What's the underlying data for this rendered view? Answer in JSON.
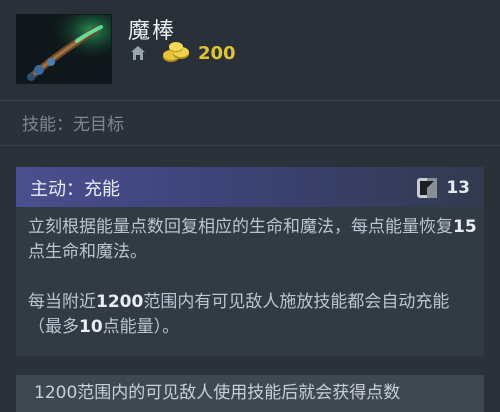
{
  "item": {
    "name": "魔棒",
    "gold_cost": "200",
    "icon": "magic-stick-icon"
  },
  "targeting": "技能：无目标",
  "active": {
    "title": "主动：充能",
    "cooldown": "13",
    "cooldown_icon": "cooldown-icon",
    "desc1_pre": "立刻根据能量点数回复相应的生命和魔法，每点能量恢复",
    "desc1_num": "15",
    "desc1_post": "点生命和魔法。",
    "desc2_pre": "每当附近",
    "desc2_num1": "1200",
    "desc2_mid": "范围内有可见敌人施放技能都会自动充能（最多",
    "desc2_num2": "10",
    "desc2_post": "点能量）。"
  },
  "note": {
    "text": "1200范围内的可见敌人使用技能后就会获得点数"
  },
  "colors": {
    "gold": "#e1c232",
    "header_gradient_start": "#4a4f8f",
    "background": "#2b3139"
  }
}
